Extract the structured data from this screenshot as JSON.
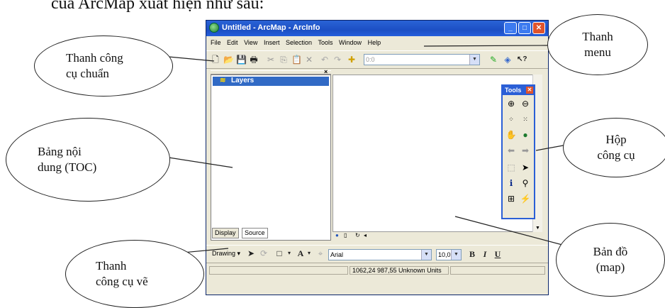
{
  "caption": "của ArcMap xuất hiện như sau:",
  "window": {
    "title": "Untitled - ArcMap - ArcInfo",
    "menu": [
      "File",
      "Edit",
      "View",
      "Insert",
      "Selection",
      "Tools",
      "Window",
      "Help"
    ],
    "scale_value": "0:0"
  },
  "toc": {
    "layers_label": "Layers",
    "tabs": [
      "Display",
      "Source"
    ]
  },
  "tools_palette": {
    "title": "Tools"
  },
  "drawing_toolbar": {
    "drawing_label": "Drawing",
    "font": "Arial",
    "font_size": "10,0",
    "bold": "B",
    "italic": "I",
    "underline": "U"
  },
  "status": {
    "coordinates": "1062,24  987,55 Unknown Units"
  },
  "callouts": {
    "standard_toolbar": [
      "Thanh công",
      "cụ chuẩn"
    ],
    "menu_bar": [
      "Thanh",
      "menu"
    ],
    "toc": [
      "Bảng nội",
      "dung  (TOC)"
    ],
    "toolbox": [
      "Hộp",
      "công cụ"
    ],
    "draw_toolbar": [
      "Thanh",
      "công cụ  vẽ"
    ],
    "map": [
      "Bản đồ",
      "(map)"
    ]
  }
}
